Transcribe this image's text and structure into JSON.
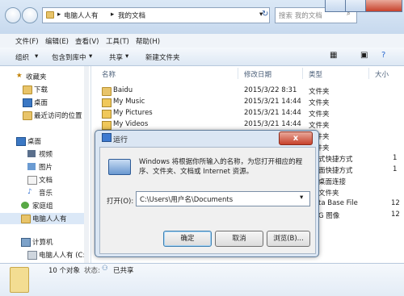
{
  "address": {
    "crumbs": [
      "电脑人人有",
      "我的文档"
    ],
    "search_placeholder": "搜索 我的文档"
  },
  "menu": [
    "文件(F)",
    "编辑(E)",
    "查看(V)",
    "工具(T)",
    "帮助(H)"
  ],
  "toolbar": {
    "organize": "组织",
    "include": "包含到库中",
    "share": "共享",
    "new_folder": "新建文件夹"
  },
  "nav": {
    "favorites": "收藏夹",
    "downloads": "下载",
    "desktop": "桌面",
    "recent": "最近访问的位置",
    "desktop2": "桌面",
    "video": "视频",
    "pictures": "图片",
    "documents": "文档",
    "music": "音乐",
    "homegroup": "家庭组",
    "user": "电脑人人有",
    "computer": "计算机",
    "drive": "电脑人人有 (C:"
  },
  "columns": {
    "name": "名称",
    "date": "修改日期",
    "type": "类型",
    "size": "大小"
  },
  "files": [
    {
      "name": "Baidu",
      "date": "2015/3/22 8:31",
      "type": "文件夹",
      "size": ""
    },
    {
      "name": "My Music",
      "date": "2015/3/21 14:44",
      "type": "文件夹",
      "size": ""
    },
    {
      "name": "My Pictures",
      "date": "2015/3/21 14:44",
      "type": "文件夹",
      "size": ""
    },
    {
      "name": "My Videos",
      "date": "2015/3/21 14:44",
      "type": "文件夹",
      "size": ""
    }
  ],
  "hidden_rows_partial": [
    {
      "type": "文件夹",
      "size": ""
    },
    {
      "type": "文件夹",
      "size": ""
    },
    {
      "type": "式快捷方式",
      "size": "1"
    },
    {
      "type": "面快捷方式",
      "size": "1"
    },
    {
      "type": "桌面连接",
      "size": ""
    },
    {
      "type": "文件夹",
      "size": ""
    },
    {
      "type": "ta Base File",
      "size": "12"
    },
    {
      "type": "G 图像",
      "size": "12"
    }
  ],
  "status": {
    "count": "10 个对象",
    "state_label": "状态:",
    "state_value": "已共享"
  },
  "run": {
    "title": "运行",
    "description": "Windows 将根据你所输入的名称，为您打开相应的程序、文件夹、文档或 Internet 资源。",
    "open_label": "打开(O):",
    "input_value": "C:\\Users\\用户名\\Documents",
    "ok": "确定",
    "cancel": "取消",
    "browse": "浏览(B)...",
    "close": "x"
  }
}
